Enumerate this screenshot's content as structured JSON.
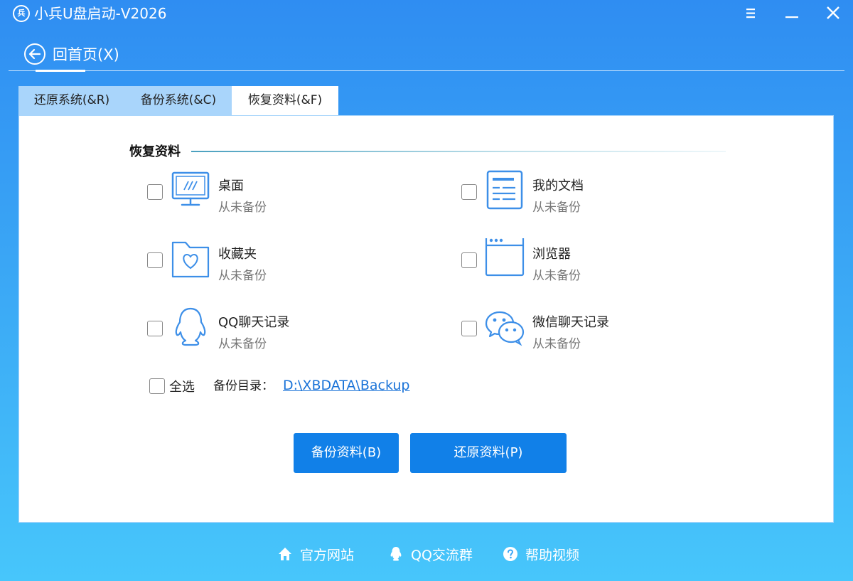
{
  "window": {
    "title": "小兵U盘启动-V2026",
    "logo_text": "兵"
  },
  "header": {
    "back_label": "回首页(X)"
  },
  "tabs": [
    {
      "label": "还原系统(&R)",
      "active": false
    },
    {
      "label": "备份系统(&C)",
      "active": false
    },
    {
      "label": "恢复资料(&F)",
      "active": true
    }
  ],
  "section": {
    "title": "恢复资料",
    "items": [
      {
        "name": "桌面",
        "status": "从未备份",
        "icon": "monitor-icon"
      },
      {
        "name": "我的文档",
        "status": "从未备份",
        "icon": "document-icon"
      },
      {
        "name": "收藏夹",
        "status": "从未备份",
        "icon": "favorites-folder-icon"
      },
      {
        "name": "浏览器",
        "status": "从未备份",
        "icon": "browser-window-icon"
      },
      {
        "name": "QQ聊天记录",
        "status": "从未备份",
        "icon": "qq-penguin-icon"
      },
      {
        "name": "微信聊天记录",
        "status": "从未备份",
        "icon": "wechat-icon"
      }
    ],
    "select_all_label": "全选",
    "backup_dir_label": "备份目录：",
    "backup_dir_path": "D:\\XBDATA\\Backup"
  },
  "actions": {
    "backup_label": "备份资料(B)",
    "restore_label": "还原资料(P)"
  },
  "footer": {
    "website_label": "官方网站",
    "qq_group_label": "QQ交流群",
    "help_video_label": "帮助视频"
  },
  "colors": {
    "accent": "#1180e8",
    "tab_inactive": "#a9d5fb",
    "icon_blue": "#3d8fe8",
    "link": "#1a73d8"
  }
}
